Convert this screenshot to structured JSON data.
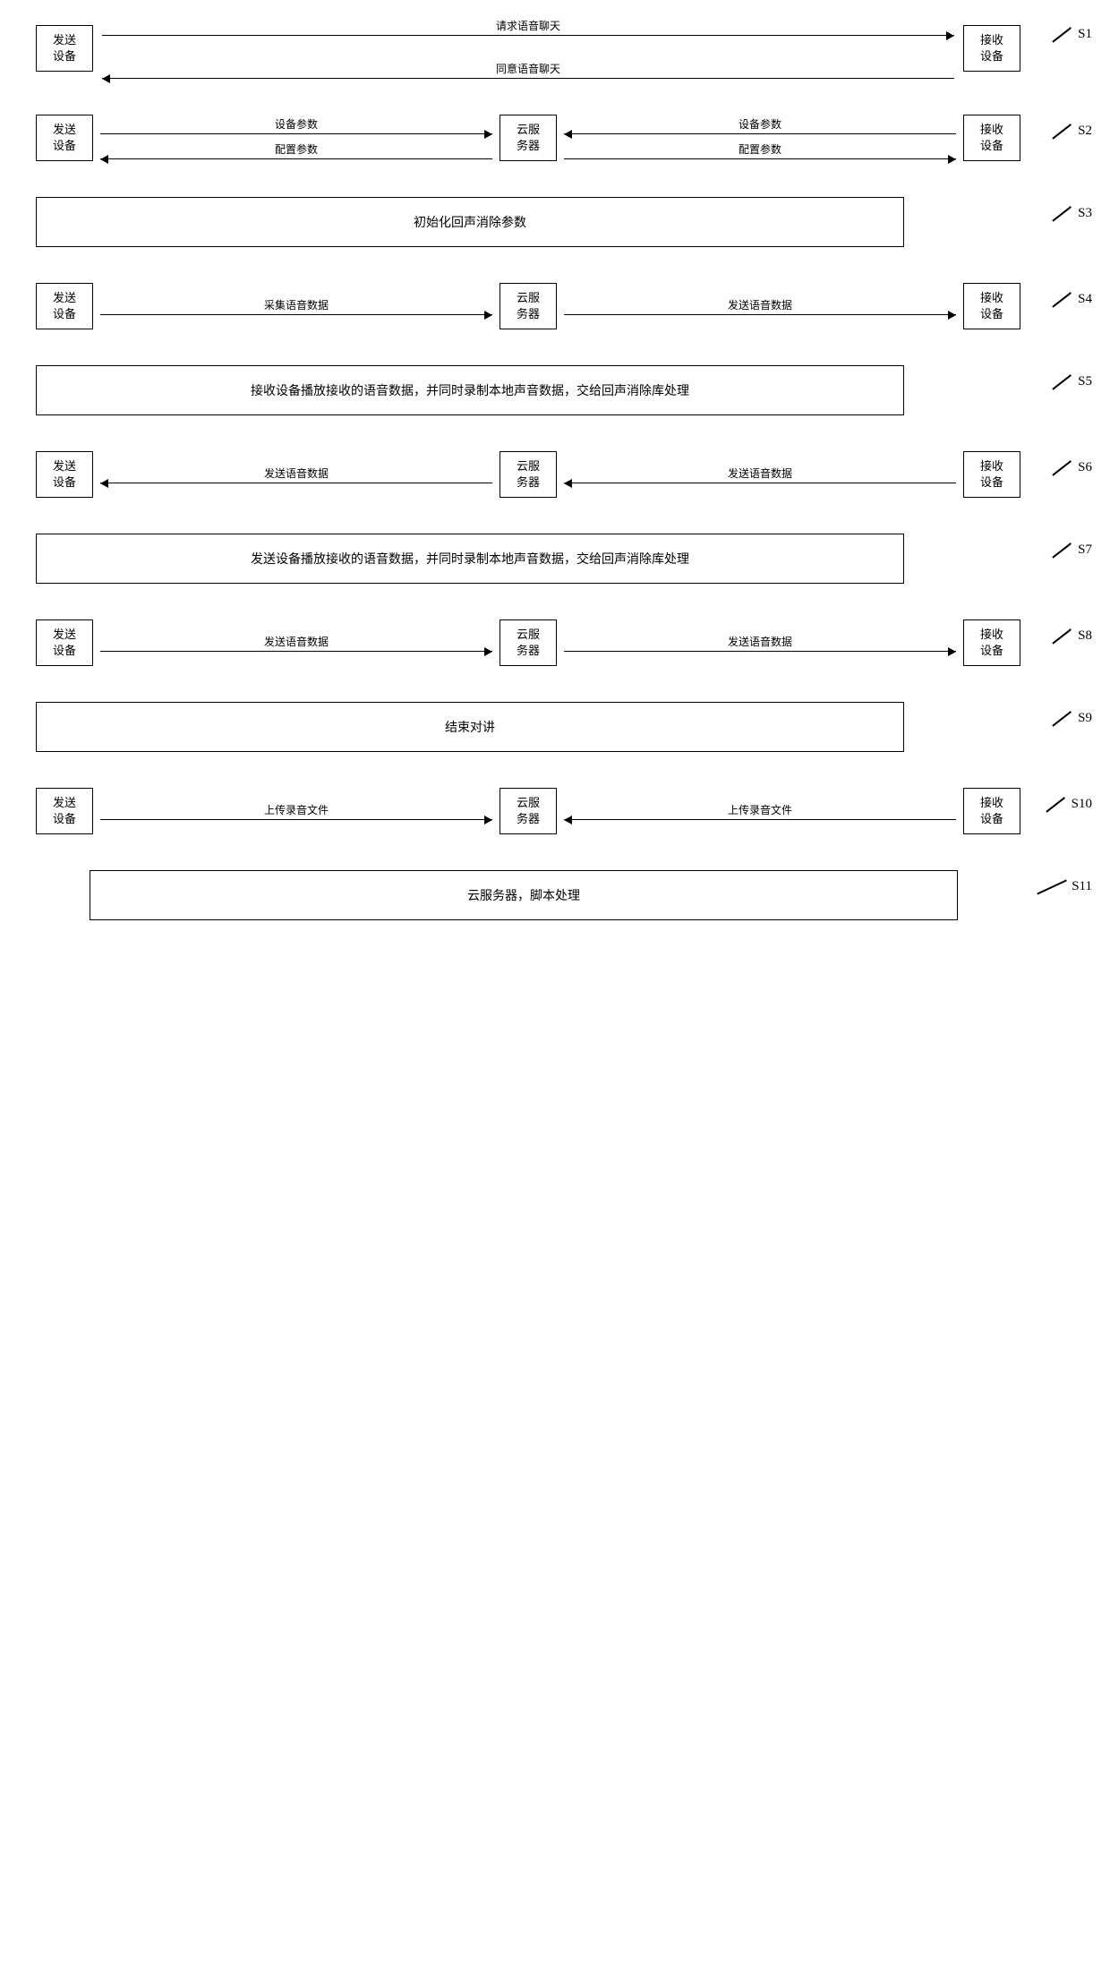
{
  "steps": [
    {
      "id": "S1",
      "type": "two-device-arrows",
      "left_device": "发送\n设备",
      "right_device": "接收\n设备",
      "arrows": [
        {
          "label": "请求语音聊天",
          "direction": "right"
        },
        {
          "label": "同意语音聊天",
          "direction": "left"
        }
      ]
    },
    {
      "id": "S2",
      "type": "three-col-arrows",
      "left_device": "发送\n设备",
      "mid_device": "云服\n务器",
      "right_device": "接收\n设备",
      "left_arrows": [
        {
          "label": "设备参数",
          "direction": "right"
        },
        {
          "label": "配置参数",
          "direction": "left"
        }
      ],
      "right_arrows": [
        {
          "label": "设备参数",
          "direction": "left"
        },
        {
          "label": "配置参数",
          "direction": "right"
        }
      ]
    },
    {
      "id": "S3",
      "type": "wide-box",
      "text": "初始化回声消除参数"
    },
    {
      "id": "S4",
      "type": "three-col-arrows-one-dir",
      "left_device": "发送\n设备",
      "mid_device": "云服\n务器",
      "right_device": "接收\n设备",
      "left_arrow_label": "采集语音数据",
      "right_arrow_label": "发送语音数据",
      "left_direction": "right",
      "right_direction": "right"
    },
    {
      "id": "S5",
      "type": "wide-box",
      "text": "接收设备播放接收的语音数据，并同时录制本地声音数据，交给回声消除库处理"
    },
    {
      "id": "S6",
      "type": "three-col-arrows-one-dir",
      "left_device": "发送\n设备",
      "mid_device": "云服\n务器",
      "right_device": "接收\n设备",
      "left_arrow_label": "发送语音数据",
      "right_arrow_label": "发送语音数据",
      "left_direction": "left",
      "right_direction": "left"
    },
    {
      "id": "S7",
      "type": "wide-box",
      "text": "发送设备播放接收的语音数据，并同时录制本地声音数据，交给回声消除库处理"
    },
    {
      "id": "S8",
      "type": "three-col-arrows-one-dir",
      "left_device": "发送\n设备",
      "mid_device": "云服\n务器",
      "right_device": "接收\n设备",
      "left_arrow_label": "发送语音数据",
      "right_arrow_label": "发送语音数据",
      "left_direction": "right",
      "right_direction": "right"
    },
    {
      "id": "S9",
      "type": "wide-box",
      "text": "结束对讲"
    },
    {
      "id": "S10",
      "type": "three-col-arrows-one-dir-reverse",
      "left_device": "发送\n设备",
      "mid_device": "云服\n务器",
      "right_device": "接收\n设备",
      "left_arrow_label": "上传录音文件",
      "right_arrow_label": "上传录音文件",
      "left_direction": "right",
      "right_direction": "left"
    },
    {
      "id": "S11",
      "type": "wide-box",
      "text": "云服务器，脚本处理"
    }
  ]
}
